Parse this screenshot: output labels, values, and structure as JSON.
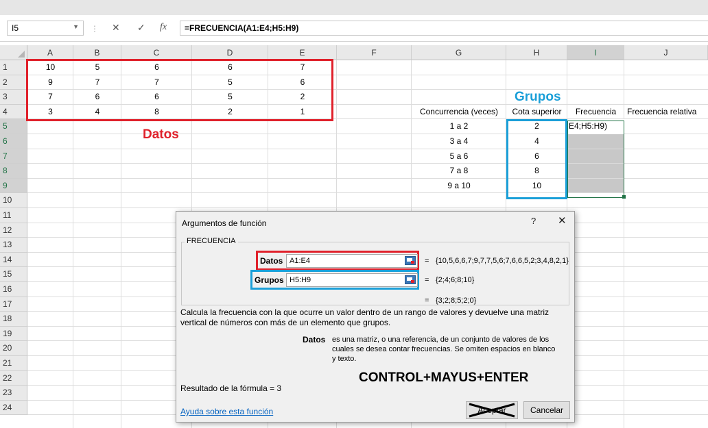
{
  "formula_bar": {
    "name_box": "I5",
    "cancel_symbol": "✕",
    "enter_symbol": "✓",
    "fx_symbol": "fx",
    "formula": "=FRECUENCIA(A1:E4;H5:H9)"
  },
  "columns": [
    "A",
    "B",
    "C",
    "D",
    "E",
    "F",
    "G",
    "H",
    "I",
    "J"
  ],
  "rows": [
    "1",
    "2",
    "3",
    "4",
    "5",
    "6",
    "7",
    "8",
    "9",
    "10",
    "11",
    "12",
    "13",
    "14",
    "15",
    "16",
    "17",
    "18",
    "19",
    "20",
    "21",
    "22",
    "23",
    "24"
  ],
  "data_values": [
    [
      "10",
      "5",
      "6",
      "6",
      "7"
    ],
    [
      "9",
      "7",
      "7",
      "5",
      "6"
    ],
    [
      "7",
      "6",
      "6",
      "5",
      "2"
    ],
    [
      "3",
      "4",
      "8",
      "2",
      "1"
    ]
  ],
  "table": {
    "headers": [
      "Concurrencia (veces)",
      "Cota superior",
      "Frecuencia",
      "Frecuencia relativa"
    ],
    "ranges": [
      "1 a 2",
      "3 a 4",
      "5 a 6",
      "7 a 8",
      "9 a 10"
    ],
    "bounds": [
      "2",
      "4",
      "6",
      "8",
      "10"
    ],
    "editing_cell": "E4;H5:H9)"
  },
  "annotations": {
    "datos_label": "Datos",
    "grupos_label": "Grupos",
    "control_text": "CONTROL+MAYUS+ENTER"
  },
  "dialog": {
    "title": "Argumentos de función",
    "help_symbol": "?",
    "close_symbol": "✕",
    "function_name": "FRECUENCIA",
    "arg1_label": "Datos",
    "arg1_value": "A1:E4",
    "arg1_result": "{10,5,6,6,7;9,7,7,5,6;7,6,6,5,2;3,4,8,2,1}",
    "arg2_label": "Grupos",
    "arg2_value": "H5:H9",
    "arg2_result": "{2;4;6;8;10}",
    "equals": "=",
    "result_value": "{3;2;8;5;2;0}",
    "description": "Calcula la frecuencia con la que ocurre un valor dentro de un rango de valores y devuelve una matriz vertical de números con más de un elemento que grupos.",
    "arg_help_label": "Datos",
    "arg_help_text": "es una matriz, o una referencia, de un conjunto de valores de los cuales se desea contar frecuencias. Se omiten espacios en blanco y texto.",
    "formula_result": "Resultado de la fórmula =  3",
    "help_link": "Ayuda sobre esta función",
    "ok_button": "Aceptar",
    "cancel_button": "Cancelar"
  }
}
